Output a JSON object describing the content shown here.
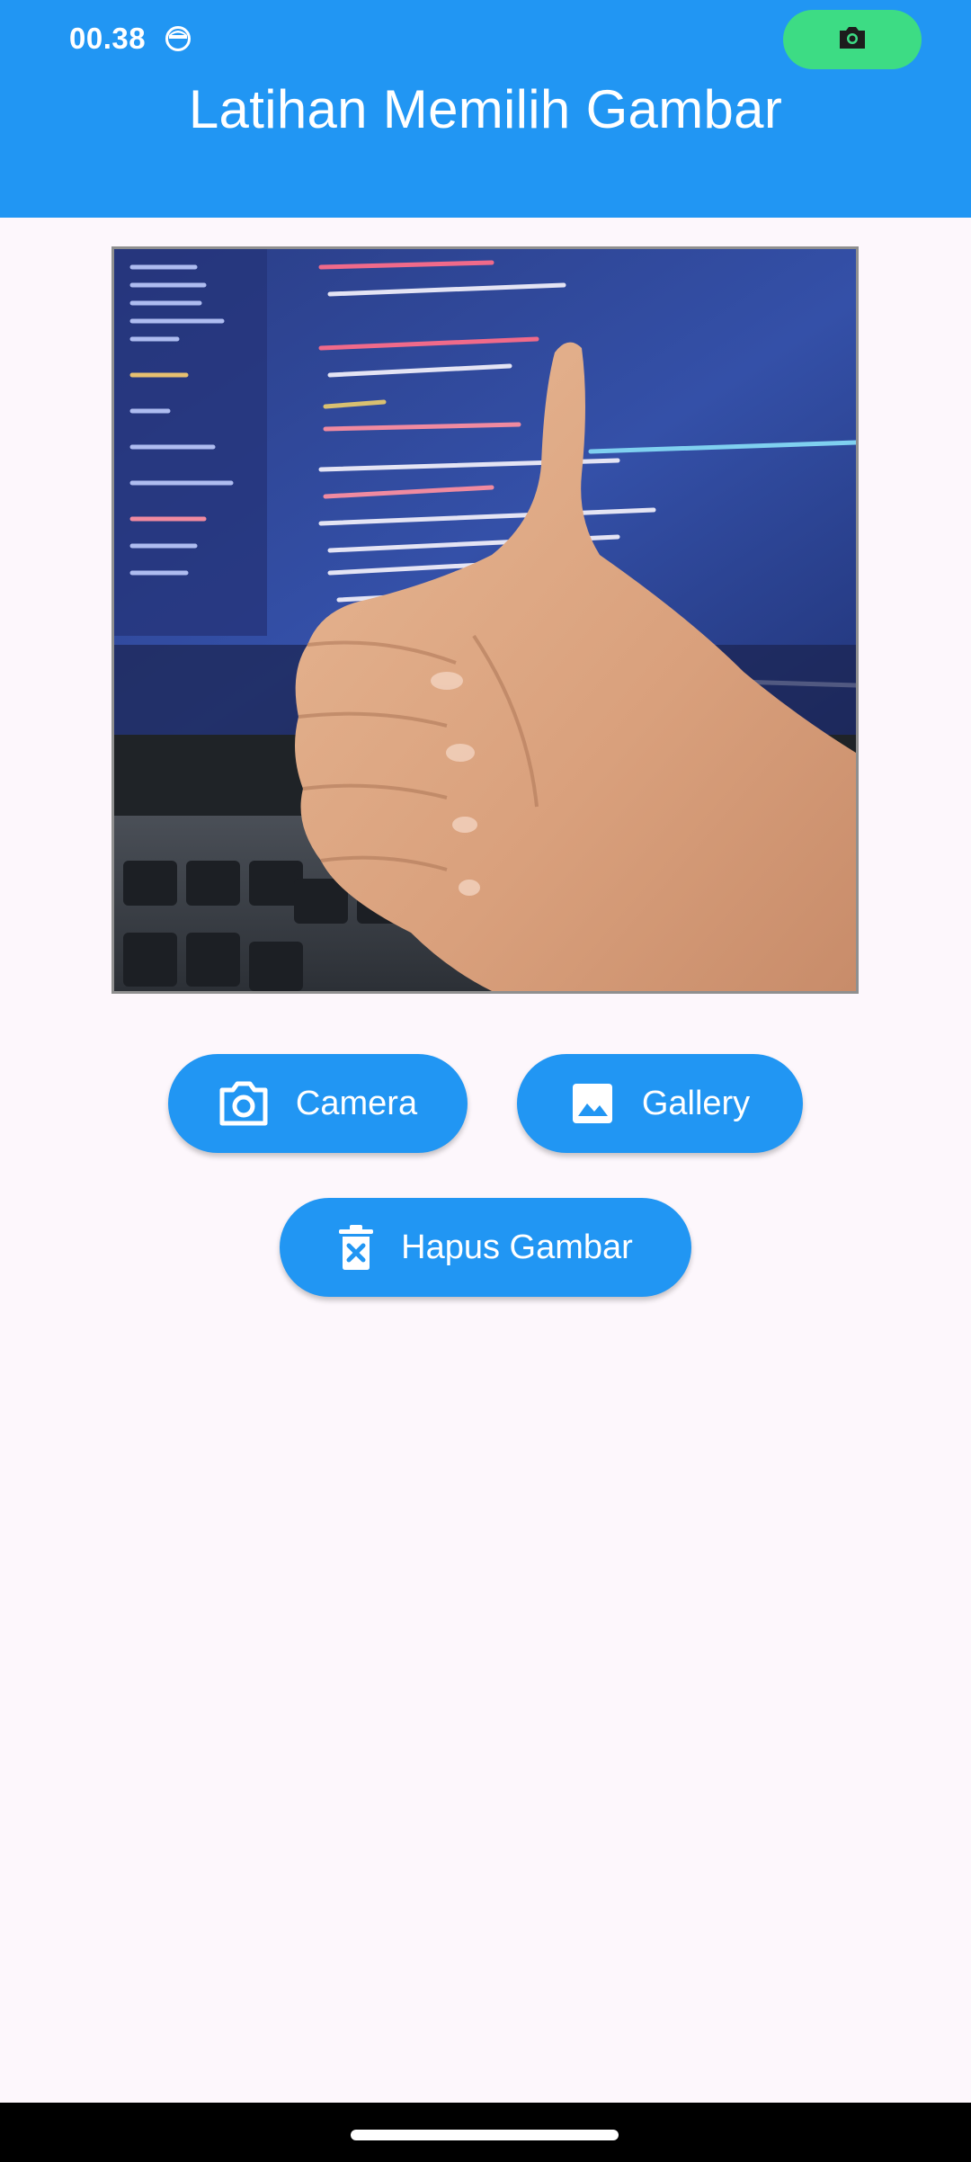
{
  "status_bar": {
    "time": "00.38",
    "left_icon": "face-icon",
    "right_icon": "camera-icon",
    "pill_color": "#3DDC84"
  },
  "app_bar": {
    "title": "Latihan Memilih Gambar",
    "color": "#2196F3"
  },
  "preview": {
    "description_icon": "selected-image"
  },
  "buttons": {
    "camera": {
      "label": "Camera",
      "icon": "camera-icon"
    },
    "gallery": {
      "label": "Gallery",
      "icon": "image-icon"
    },
    "delete": {
      "label": "Hapus Gambar",
      "icon": "delete-icon"
    }
  },
  "colors": {
    "background": "#FDF7FC",
    "primary": "#2196F3",
    "on_primary": "#FFFFFF"
  },
  "nav_bar": {
    "handle": "gesture-handle"
  }
}
